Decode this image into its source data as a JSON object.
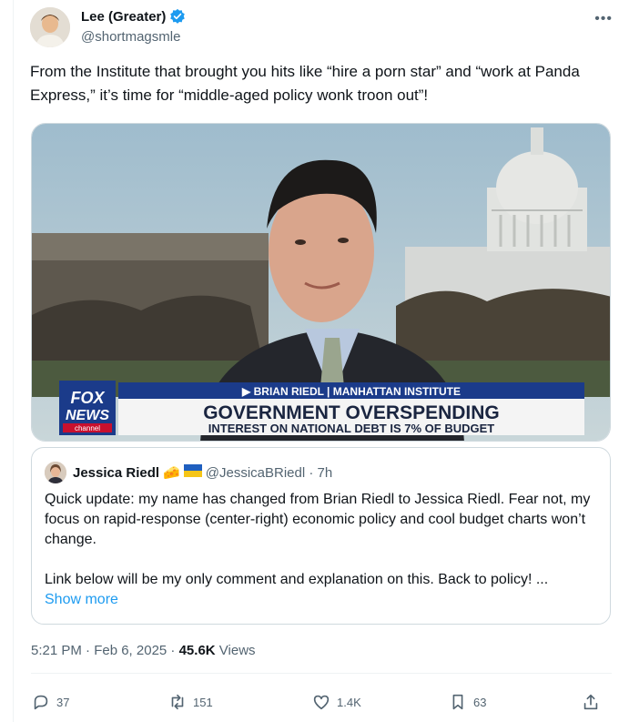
{
  "author": {
    "display_name": "Lee (Greater)",
    "handle": "@shortmagsmle",
    "verified": true
  },
  "tweet_text": "From the Institute that brought you hits like “hire a porn star” and “work at Panda Express,” it’s time for “middle-aged policy wonk troon out”!",
  "media": {
    "chyron_name": "▶ BRIAN RIEDL | MANHATTAN INSTITUTE",
    "headline": "GOVERNMENT OVERSPENDING",
    "subline": "INTEREST ON NATIONAL DEBT IS 7% OF BUDGET",
    "logo_line1": "FOX",
    "logo_line2": "NEWS",
    "logo_line3": "channel"
  },
  "quote": {
    "display_name": "Jessica Riedl",
    "emoji": "🧀",
    "handle_time": "@JessicaBRiedl · 7h",
    "paragraph1": "Quick update: my name has changed from Brian Riedl to Jessica Riedl. Fear not, my focus on rapid-response (center-right) economic policy and cool budget charts won’t change.",
    "paragraph2": "Link below will be my only comment and explanation on this. Back to policy! ...",
    "show_more": "Show more"
  },
  "meta": {
    "time": "5:21 PM · Feb 6, 2025 · ",
    "views_count": "45.6K",
    "views_label": " Views"
  },
  "actions": {
    "replies": "37",
    "reposts": "151",
    "likes": "1.4K",
    "bookmarks": "63"
  },
  "colors": {
    "accent": "#1d9bf0",
    "secondary_text": "#536471",
    "fox_blue": "#1b3b8a",
    "fox_red": "#c8102e"
  }
}
